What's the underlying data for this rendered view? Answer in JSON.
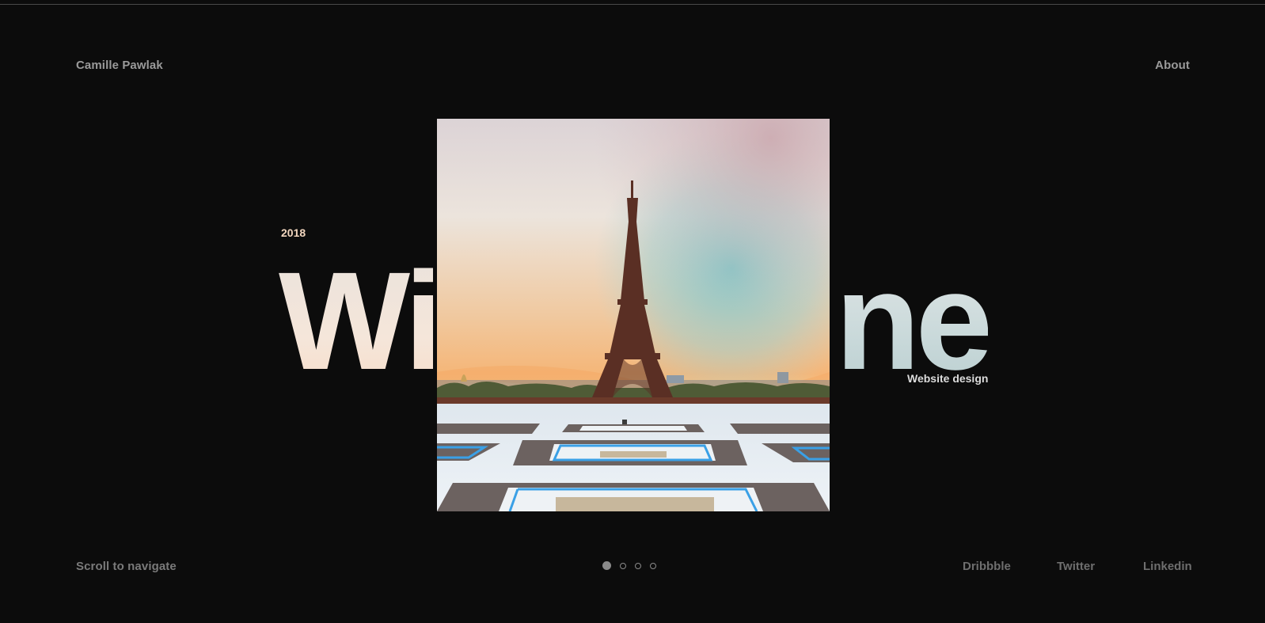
{
  "header": {
    "brand": "Camille Pawlak",
    "about_label": "About"
  },
  "project": {
    "year": "2018",
    "title_left": "Wi",
    "title_right": "ne",
    "subtitle": "Website design",
    "image_alt": "Eiffel Tower at sunset seen from Trocadéro"
  },
  "footer": {
    "scroll_hint": "Scroll to navigate",
    "pager": {
      "count": 4,
      "active": 0
    },
    "social": [
      "Dribbble",
      "Twitter",
      "Linkedin"
    ]
  },
  "colors": {
    "background": "#0c0c0c",
    "nav_text": "#9a9a9a",
    "year": "#f3d7bf",
    "subtitle": "#dcdcdc"
  }
}
